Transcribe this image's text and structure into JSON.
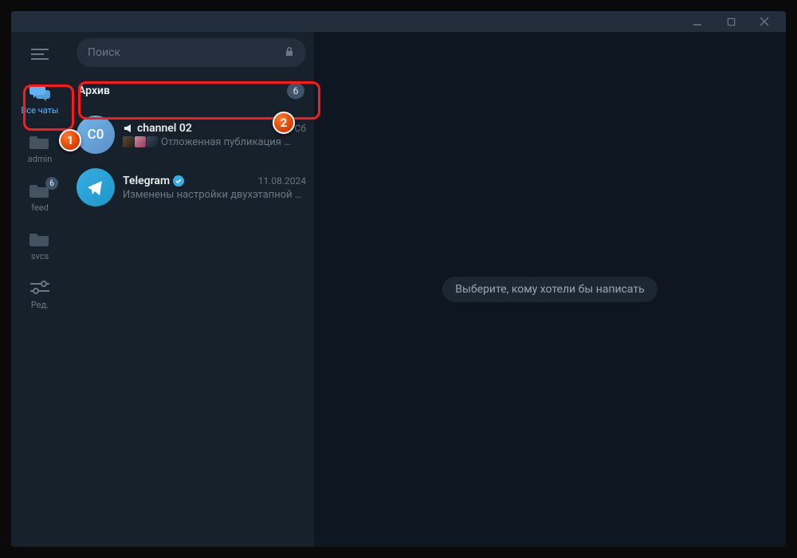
{
  "window": {
    "search_placeholder": "Поиск"
  },
  "rail": {
    "folders": [
      {
        "label": "Все чаты",
        "badge": null
      },
      {
        "label": "admin",
        "badge": null
      },
      {
        "label": "feed",
        "badge": "6"
      },
      {
        "label": "svcs",
        "badge": null
      },
      {
        "label": "Ред.",
        "badge": null
      }
    ]
  },
  "archive": {
    "title": "Архив",
    "badge": "6"
  },
  "chats": [
    {
      "avatar_text": "C0",
      "name": "channel 02",
      "date": "Сб",
      "preview": "Отложенная публикация …"
    },
    {
      "avatar_text": "",
      "name": "Telegram",
      "date": "11.08.2024",
      "preview": "Изменены настройки двухэтапной …"
    }
  ],
  "main": {
    "placeholder": "Выберите, кому хотели бы написать"
  },
  "markers": {
    "one": "1",
    "two": "2"
  }
}
